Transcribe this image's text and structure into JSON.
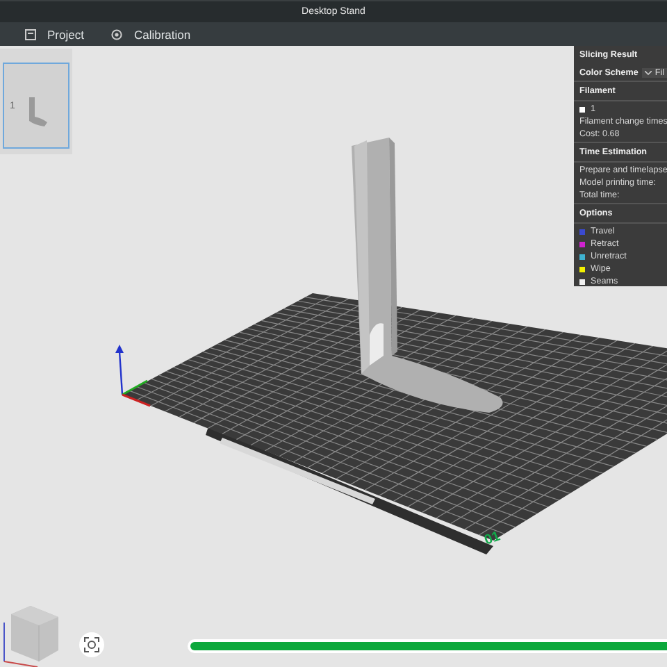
{
  "window": {
    "title": "Desktop Stand"
  },
  "tabs": [
    {
      "label": "Project"
    },
    {
      "label": "Calibration"
    }
  ],
  "plates": [
    {
      "label": "1",
      "selected": true
    }
  ],
  "slicing_result": {
    "title": "Slicing Result",
    "color_scheme": {
      "label": "Color Scheme",
      "value": "Fil"
    },
    "sections": [
      {
        "title": "Filament",
        "lines": [
          {
            "kind": "swatch",
            "color": "#ffffff",
            "text": "1"
          },
          {
            "kind": "text",
            "text": "Filament change times"
          },
          {
            "kind": "text",
            "text": "Cost:  0.68"
          }
        ]
      },
      {
        "title": "Time Estimation",
        "lines": [
          {
            "kind": "text",
            "text": "Prepare and timelapse"
          },
          {
            "kind": "text",
            "text": "Model printing time:"
          },
          {
            "kind": "text",
            "text": "Total time:"
          }
        ]
      },
      {
        "title": "Options",
        "lines": [
          {
            "kind": "swatch",
            "color": "#3b4ad0",
            "text": "Travel"
          },
          {
            "kind": "swatch",
            "color": "#d022d0",
            "text": "Retract"
          },
          {
            "kind": "swatch",
            "color": "#3fb2d0",
            "text": "Unretract"
          },
          {
            "kind": "swatch",
            "color": "#f2f000",
            "text": "Wipe"
          },
          {
            "kind": "swatch",
            "color": "#f0f0f0",
            "text": "Seams"
          }
        ]
      }
    ]
  },
  "plate_number": "01",
  "progress": {
    "level": 1
  }
}
